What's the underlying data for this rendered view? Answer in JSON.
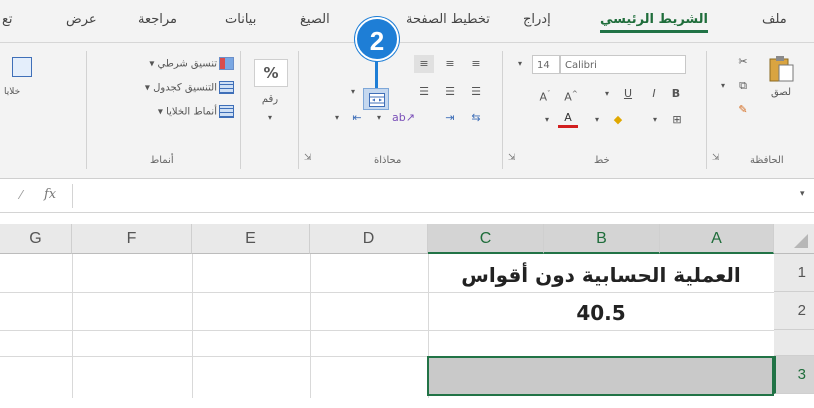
{
  "tabs": [
    {
      "label": "ملف",
      "active": false
    },
    {
      "label": "الشريط الرئيسي",
      "active": true
    },
    {
      "label": "إدراج",
      "active": false
    },
    {
      "label": "تخطيط الصفحة",
      "active": false
    },
    {
      "label": "الصيغ",
      "active": false
    },
    {
      "label": "بيانات",
      "active": false
    },
    {
      "label": "مراجعة",
      "active": false
    },
    {
      "label": "عرض",
      "active": false
    },
    {
      "label": "تع",
      "active": false
    }
  ],
  "ribbon": {
    "clipboard": {
      "paste_label": "لصق",
      "group_label": "الحافظة"
    },
    "font": {
      "font_name": "Calibri",
      "font_size": "14",
      "bold": "B",
      "italic": "I",
      "underline": "U",
      "group_label": "خط"
    },
    "alignment": {
      "group_label": "محاذاة"
    },
    "number": {
      "percent": "%",
      "number_label": "رقم",
      "group_label": ""
    },
    "styles": {
      "conditional_formatting": "تنسيق شرطي",
      "format_as_table": "التنسيق كجدول",
      "cell_styles": "أنماط الخلايا",
      "group_label": "أنماط"
    },
    "cells": {
      "label": "خلايا"
    }
  },
  "callout": {
    "number": "2"
  },
  "formula_bar": {
    "fx_label": "fx",
    "value": ""
  },
  "grid": {
    "columns": [
      "G",
      "F",
      "E",
      "D",
      "C",
      "B",
      "A"
    ],
    "rows": [
      "1",
      "2",
      "3"
    ],
    "cells": {
      "merged_row1": "العملية الحسابية دون أقواس",
      "merged_row2": "40.5",
      "merged_row3": ""
    }
  },
  "colors": {
    "accent_green": "#217346",
    "callout_blue": "#1e7ed6",
    "selected_fill": "#c9c9c9"
  }
}
